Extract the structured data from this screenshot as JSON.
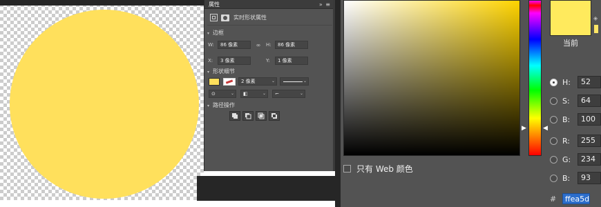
{
  "colors": {
    "shape_fill": "#ffe05c",
    "current_color": "#ffea5d",
    "hue_color": "#ffd400"
  },
  "properties_panel": {
    "tab_label": "属性",
    "panel_controls": "»  ≡",
    "layer_type_label": "实时形状属性",
    "sections": {
      "transform": "边框",
      "appearance": "形状细节",
      "path_ops": "路径操作"
    },
    "transform": {
      "w_label": "W:",
      "w_value": "86 像素",
      "h_label": "H:",
      "h_value": "86 像素",
      "x_label": "X:",
      "x_value": "3 像素",
      "y_label": "Y:",
      "y_value": "1 像素"
    },
    "appearance": {
      "stroke_width": "2 像素"
    },
    "icons": {
      "shape_icon": "rectangle-shape-icon",
      "mask_icon": "mask-icon",
      "link_icon": "link-icon",
      "stroke_style_icon": "stroke-line-icon",
      "path_op_icons": [
        "combine-shapes-icon",
        "subtract-front-icon",
        "intersect-shapes-icon",
        "exclude-overlap-icon"
      ]
    }
  },
  "color_picker": {
    "current_label": "当前",
    "fields": [
      {
        "label": "H:",
        "value": "52",
        "selected": true
      },
      {
        "label": "S:",
        "value": "64",
        "selected": false
      },
      {
        "label": "B:",
        "value": "100",
        "selected": false
      },
      {
        "label": "R:",
        "value": "255",
        "selected": false
      },
      {
        "label": "G:",
        "value": "234",
        "selected": false
      },
      {
        "label": "B:",
        "value": "93",
        "selected": false
      }
    ],
    "web_only_label": "只有 Web 颜色",
    "hex_prefix": "#",
    "hex_value": "ffea5d"
  }
}
